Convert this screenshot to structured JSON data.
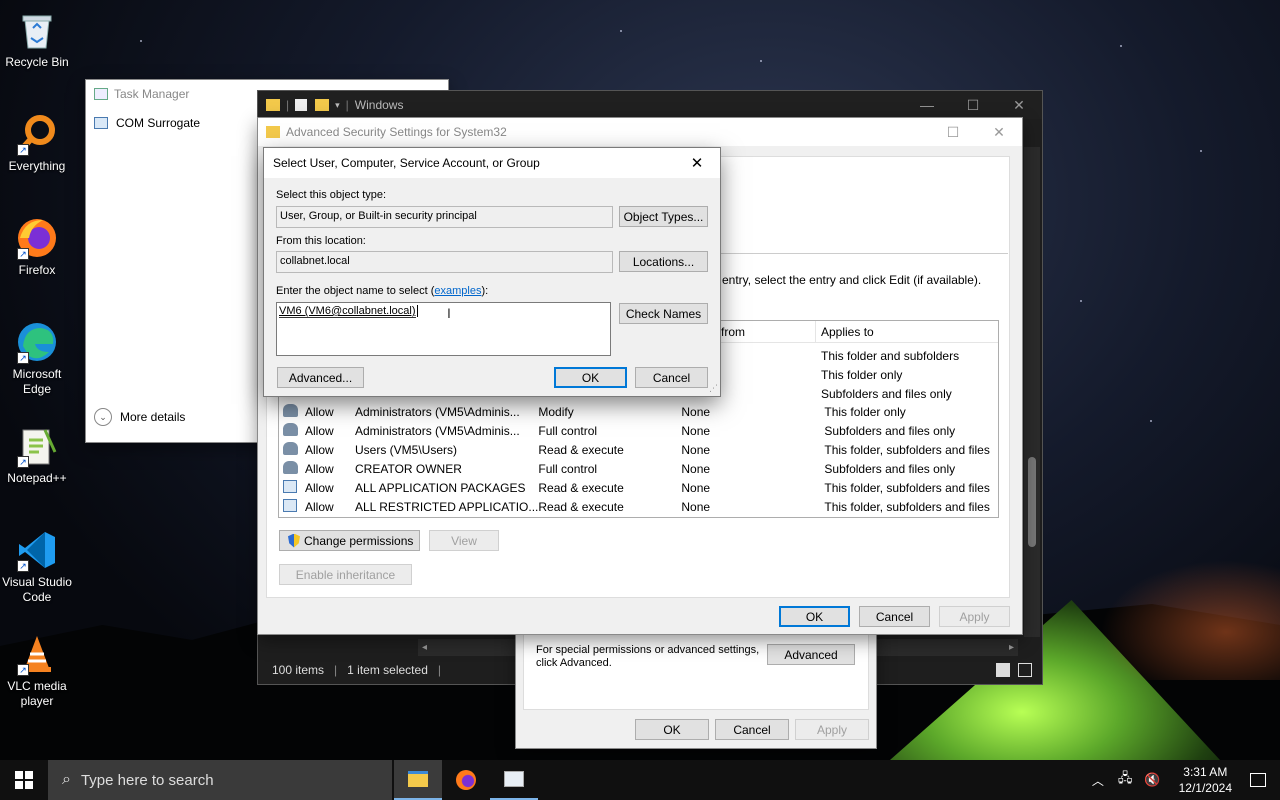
{
  "desktop_icons": [
    {
      "label": "Recycle Bin"
    },
    {
      "label": "Everything"
    },
    {
      "label": "Firefox"
    },
    {
      "label": "Microsoft Edge"
    },
    {
      "label": "Notepad++"
    },
    {
      "label": "Visual Studio Code"
    },
    {
      "label": "VLC media player"
    }
  ],
  "task_manager": {
    "title": "Task Manager",
    "process": "COM Surrogate",
    "more_details": "More details"
  },
  "explorer": {
    "title": "Windows",
    "status_items": "100 items",
    "status_selected": "1 item selected"
  },
  "props_dialog": {
    "info_text": "For special permissions or advanced settings, click Advanced.",
    "advanced_btn": "Advanced",
    "ok": "OK",
    "cancel": "Cancel",
    "apply": "Apply"
  },
  "adv_security": {
    "title": "Advanced Security Settings for System32",
    "instructions": "entry, select the entry and click Edit (if available).",
    "col_inherited": "d from",
    "col_applies": "Applies to",
    "top_rows": [
      {
        "applies": "This folder and subfolders"
      },
      {
        "applies": "This folder only"
      },
      {
        "applies": "Subfolders and files only"
      }
    ],
    "rows": [
      {
        "type": "Allow",
        "principal": "Administrators (VM5\\Adminis...",
        "access": "Modify",
        "inherited": "None",
        "applies": "This folder only"
      },
      {
        "type": "Allow",
        "principal": "Administrators (VM5\\Adminis...",
        "access": "Full control",
        "inherited": "None",
        "applies": "Subfolders and files only"
      },
      {
        "type": "Allow",
        "principal": "Users (VM5\\Users)",
        "access": "Read & execute",
        "inherited": "None",
        "applies": "This folder, subfolders and files"
      },
      {
        "type": "Allow",
        "principal": "CREATOR OWNER",
        "access": "Full control",
        "inherited": "None",
        "applies": "Subfolders and files only"
      },
      {
        "type": "Allow",
        "principal": "ALL APPLICATION PACKAGES",
        "access": "Read & execute",
        "inherited": "None",
        "applies": "This folder, subfolders and files"
      },
      {
        "type": "Allow",
        "principal": "ALL RESTRICTED APPLICATIO...",
        "access": "Read & execute",
        "inherited": "None",
        "applies": "This folder, subfolders and files"
      }
    ],
    "change_permissions": "Change permissions",
    "view": "View",
    "enable_inheritance": "Enable inheritance",
    "ok": "OK",
    "cancel": "Cancel",
    "apply": "Apply"
  },
  "select_dialog": {
    "title": "Select User, Computer, Service Account, or Group",
    "object_type_label": "Select this object type:",
    "object_type_value": "User, Group, or Built-in security principal",
    "object_types_btn": "Object Types...",
    "location_label": "From this location:",
    "location_value": "collabnet.local",
    "locations_btn": "Locations...",
    "name_label_prefix": "Enter the object name to select (",
    "name_label_link": "examples",
    "name_label_suffix": "):",
    "name_value": "VM6 (VM6@collabnet.local)",
    "check_names_btn": "Check Names",
    "advanced_btn": "Advanced...",
    "ok": "OK",
    "cancel": "Cancel"
  },
  "taskbar": {
    "search_placeholder": "Type here to search",
    "time": "3:31 AM",
    "date": "12/1/2024"
  }
}
